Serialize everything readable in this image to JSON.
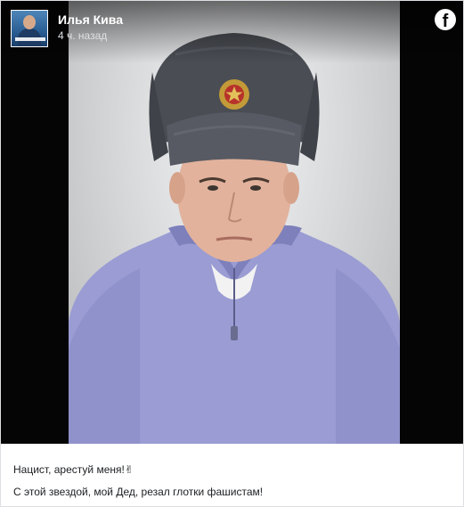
{
  "post": {
    "author": "Илья Кива",
    "time": "4 ч. назад",
    "text_line1": "Нацист, арестуй меня!✌",
    "text_line2": "С этой звездой, мой Дед, резал глотки фашистам!"
  },
  "icons": {
    "platform_logo": "facebook-icon"
  },
  "colors": {
    "media_background": "#050505",
    "caption_text": "#1c1e21",
    "author_text": "#ffffff"
  }
}
